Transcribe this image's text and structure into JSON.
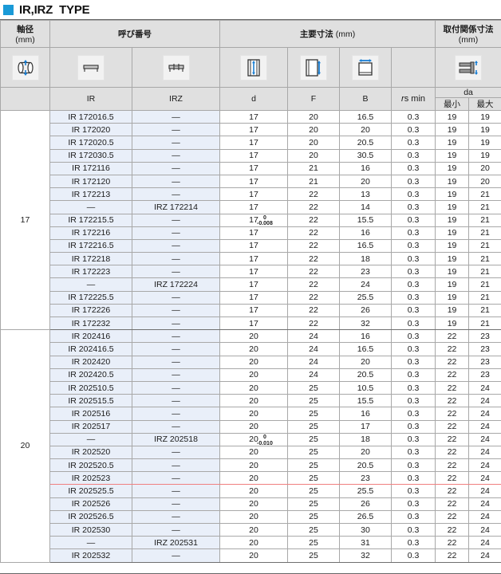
{
  "title": {
    "text": "IR,IRZ  TYPE",
    "accent_color": "#1a9ad7"
  },
  "header": {
    "shaft_dia": {
      "label": "軸径",
      "unit": "(mm)",
      "icon": "shaft-diameter-icon"
    },
    "designation": {
      "label": "呼び番号",
      "sub": [
        "IR",
        "IRZ"
      ],
      "icons": [
        "ir-bushing-icon",
        "irz-flanged-bushing-icon"
      ]
    },
    "main_dims": {
      "label": "主要寸法",
      "unit": "(mm)",
      "sub": [
        "d",
        "F",
        "B"
      ],
      "rs_label": "rs min",
      "icons": [
        "dimension-d-icon",
        "dimension-f-icon",
        "dimension-b-icon"
      ]
    },
    "mounting_dims": {
      "label": "取付関係寸法",
      "unit": "(mm)",
      "group": "da",
      "sub": [
        "最小",
        "最大"
      ],
      "icon": "mounting-da-icon"
    }
  },
  "blocks": [
    {
      "shaft": "17",
      "tolerance": {
        "row_index": 8,
        "upper": "0",
        "lower": "-0.008"
      },
      "rows": [
        {
          "ir": "IR 172016.5",
          "irz": "—",
          "d": "17",
          "f": "20",
          "b": "16.5",
          "rs": "0.3",
          "da_min": "19",
          "da_max": "19"
        },
        {
          "ir": "IR 172020",
          "irz": "—",
          "d": "17",
          "f": "20",
          "b": "20",
          "rs": "0.3",
          "da_min": "19",
          "da_max": "19"
        },
        {
          "ir": "IR 172020.5",
          "irz": "—",
          "d": "17",
          "f": "20",
          "b": "20.5",
          "rs": "0.3",
          "da_min": "19",
          "da_max": "19"
        },
        {
          "ir": "IR 172030.5",
          "irz": "—",
          "d": "17",
          "f": "20",
          "b": "30.5",
          "rs": "0.3",
          "da_min": "19",
          "da_max": "19"
        },
        {
          "ir": "IR 172116",
          "irz": "—",
          "d": "17",
          "f": "21",
          "b": "16",
          "rs": "0.3",
          "da_min": "19",
          "da_max": "20"
        },
        {
          "ir": "IR 172120",
          "irz": "—",
          "d": "17",
          "f": "21",
          "b": "20",
          "rs": "0.3",
          "da_min": "19",
          "da_max": "20"
        },
        {
          "ir": "IR 172213",
          "irz": "—",
          "d": "17",
          "f": "22",
          "b": "13",
          "rs": "0.3",
          "da_min": "19",
          "da_max": "21"
        },
        {
          "ir": "—",
          "irz": "IRZ 172214",
          "d": "17",
          "f": "22",
          "b": "14",
          "rs": "0.3",
          "da_min": "19",
          "da_max": "21"
        },
        {
          "ir": "IR 172215.5",
          "irz": "—",
          "d": "17",
          "f": "22",
          "b": "15.5",
          "rs": "0.3",
          "da_min": "19",
          "da_max": "21"
        },
        {
          "ir": "IR 172216",
          "irz": "—",
          "d": "17",
          "f": "22",
          "b": "16",
          "rs": "0.3",
          "da_min": "19",
          "da_max": "21"
        },
        {
          "ir": "IR 172216.5",
          "irz": "—",
          "d": "17",
          "f": "22",
          "b": "16.5",
          "rs": "0.3",
          "da_min": "19",
          "da_max": "21"
        },
        {
          "ir": "IR 172218",
          "irz": "—",
          "d": "17",
          "f": "22",
          "b": "18",
          "rs": "0.3",
          "da_min": "19",
          "da_max": "21"
        },
        {
          "ir": "IR 172223",
          "irz": "—",
          "d": "17",
          "f": "22",
          "b": "23",
          "rs": "0.3",
          "da_min": "19",
          "da_max": "21"
        },
        {
          "ir": "—",
          "irz": "IRZ 172224",
          "d": "17",
          "f": "22",
          "b": "24",
          "rs": "0.3",
          "da_min": "19",
          "da_max": "21"
        },
        {
          "ir": "IR 172225.5",
          "irz": "—",
          "d": "17",
          "f": "22",
          "b": "25.5",
          "rs": "0.3",
          "da_min": "19",
          "da_max": "21"
        },
        {
          "ir": "IR 172226",
          "irz": "—",
          "d": "17",
          "f": "22",
          "b": "26",
          "rs": "0.3",
          "da_min": "19",
          "da_max": "21"
        },
        {
          "ir": "IR 172232",
          "irz": "—",
          "d": "17",
          "f": "22",
          "b": "32",
          "rs": "0.3",
          "da_min": "19",
          "da_max": "21"
        }
      ]
    },
    {
      "shaft": "20",
      "tolerance": {
        "row_index": 8,
        "upper": "0",
        "lower": "-0.010"
      },
      "red_line_after_row": 11,
      "rows": [
        {
          "ir": "IR 202416",
          "irz": "—",
          "d": "20",
          "f": "24",
          "b": "16",
          "rs": "0.3",
          "da_min": "22",
          "da_max": "23"
        },
        {
          "ir": "IR 202416.5",
          "irz": "—",
          "d": "20",
          "f": "24",
          "b": "16.5",
          "rs": "0.3",
          "da_min": "22",
          "da_max": "23"
        },
        {
          "ir": "IR 202420",
          "irz": "—",
          "d": "20",
          "f": "24",
          "b": "20",
          "rs": "0.3",
          "da_min": "22",
          "da_max": "23"
        },
        {
          "ir": "IR 202420.5",
          "irz": "—",
          "d": "20",
          "f": "24",
          "b": "20.5",
          "rs": "0.3",
          "da_min": "22",
          "da_max": "23"
        },
        {
          "ir": "IR 202510.5",
          "irz": "—",
          "d": "20",
          "f": "25",
          "b": "10.5",
          "rs": "0.3",
          "da_min": "22",
          "da_max": "24"
        },
        {
          "ir": "IR 202515.5",
          "irz": "—",
          "d": "20",
          "f": "25",
          "b": "15.5",
          "rs": "0.3",
          "da_min": "22",
          "da_max": "24"
        },
        {
          "ir": "IR 202516",
          "irz": "—",
          "d": "20",
          "f": "25",
          "b": "16",
          "rs": "0.3",
          "da_min": "22",
          "da_max": "24"
        },
        {
          "ir": "IR 202517",
          "irz": "—",
          "d": "20",
          "f": "25",
          "b": "17",
          "rs": "0.3",
          "da_min": "22",
          "da_max": "24"
        },
        {
          "ir": "—",
          "irz": "IRZ 202518",
          "d": "20",
          "f": "25",
          "b": "18",
          "rs": "0.3",
          "da_min": "22",
          "da_max": "24"
        },
        {
          "ir": "IR 202520",
          "irz": "—",
          "d": "20",
          "f": "25",
          "b": "20",
          "rs": "0.3",
          "da_min": "22",
          "da_max": "24"
        },
        {
          "ir": "IR 202520.5",
          "irz": "—",
          "d": "20",
          "f": "25",
          "b": "20.5",
          "rs": "0.3",
          "da_min": "22",
          "da_max": "24"
        },
        {
          "ir": "IR 202523",
          "irz": "—",
          "d": "20",
          "f": "25",
          "b": "23",
          "rs": "0.3",
          "da_min": "22",
          "da_max": "24"
        },
        {
          "ir": "IR 202525.5",
          "irz": "—",
          "d": "20",
          "f": "25",
          "b": "25.5",
          "rs": "0.3",
          "da_min": "22",
          "da_max": "24"
        },
        {
          "ir": "IR 202526",
          "irz": "—",
          "d": "20",
          "f": "25",
          "b": "26",
          "rs": "0.3",
          "da_min": "22",
          "da_max": "24"
        },
        {
          "ir": "IR 202526.5",
          "irz": "—",
          "d": "20",
          "f": "25",
          "b": "26.5",
          "rs": "0.3",
          "da_min": "22",
          "da_max": "24"
        },
        {
          "ir": "IR 202530",
          "irz": "—",
          "d": "20",
          "f": "25",
          "b": "30",
          "rs": "0.3",
          "da_min": "22",
          "da_max": "24"
        },
        {
          "ir": "—",
          "irz": "IRZ 202531",
          "d": "20",
          "f": "25",
          "b": "31",
          "rs": "0.3",
          "da_min": "22",
          "da_max": "24"
        },
        {
          "ir": "IR 202532",
          "irz": "—",
          "d": "20",
          "f": "25",
          "b": "32",
          "rs": "0.3",
          "da_min": "22",
          "da_max": "24"
        }
      ]
    }
  ]
}
